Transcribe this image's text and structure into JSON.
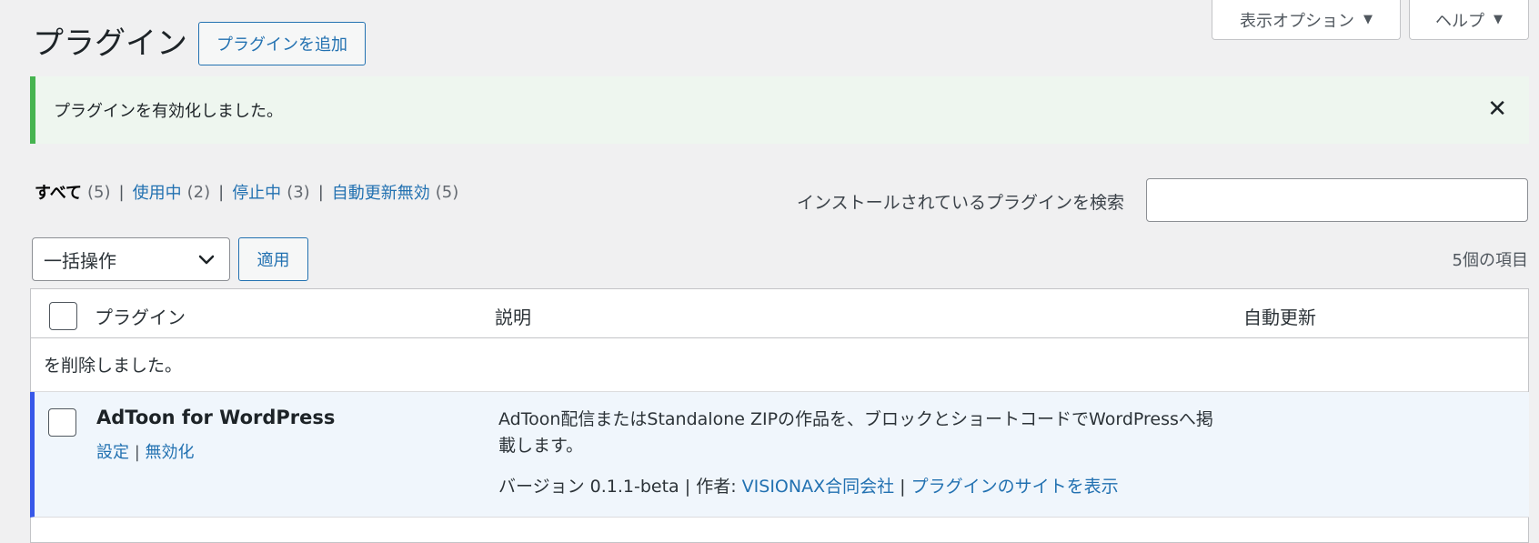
{
  "screen_meta": {
    "screen_options_label": "表示オプション",
    "help_label": "ヘルプ"
  },
  "header": {
    "title": "プラグイン",
    "add_new_label": "プラグインを追加"
  },
  "notice": {
    "message": "プラグインを有効化しました。",
    "dismiss_glyph": "✕"
  },
  "filters": [
    {
      "label": "すべて",
      "count": "(5)"
    },
    {
      "label": "使用中",
      "count": "(2)"
    },
    {
      "label": "停止中",
      "count": "(3)"
    },
    {
      "label": "自動更新無効",
      "count": "(5)"
    }
  ],
  "search": {
    "label": "インストールされているプラグインを検索",
    "value": ""
  },
  "bulk": {
    "selected": "一括操作",
    "apply_label": "適用",
    "items_count": "5個の項目"
  },
  "table": {
    "columns": {
      "plugin": "プラグイン",
      "description": "説明",
      "auto_update": "自動更新"
    },
    "deleted_message": "を削除しました。",
    "rows": [
      {
        "name": "AdToon for WordPress",
        "actions": {
          "settings": "設定",
          "deactivate": "無効化"
        },
        "description": "AdToon配信またはStandalone ZIPの作品を、ブロックとショートコードでWordPressへ掲載します。",
        "version_text": "バージョン 0.1.1-beta",
        "author_prefix": "作者:",
        "author": "VISIONAX合同会社",
        "site_link": "プラグインのサイトを表示"
      }
    ]
  }
}
